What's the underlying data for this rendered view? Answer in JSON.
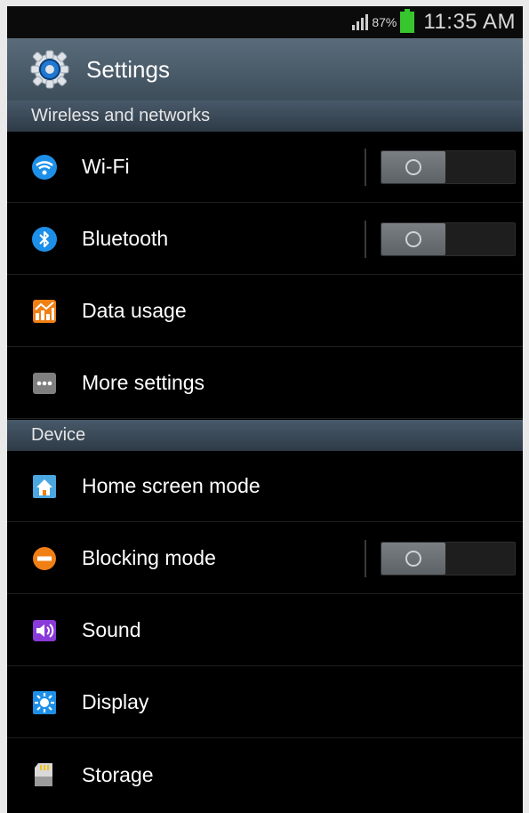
{
  "status_bar": {
    "battery": "87%",
    "time": "11:35 AM"
  },
  "title_bar": {
    "title": "Settings",
    "icon": "gear-icon"
  },
  "sections": {
    "wireless": "Wireless and networks",
    "device": "Device"
  },
  "items": {
    "wifi": {
      "label": "Wi-Fi",
      "icon": "wifi-icon",
      "toggle": "off"
    },
    "bluetooth": {
      "label": "Bluetooth",
      "icon": "bluetooth-icon",
      "toggle": "off"
    },
    "data_usage": {
      "label": "Data usage",
      "icon": "data-usage-icon"
    },
    "more_settings": {
      "label": "More settings",
      "icon": "more-icon"
    },
    "home_screen": {
      "label": "Home screen mode",
      "icon": "home-icon"
    },
    "blocking": {
      "label": "Blocking mode",
      "icon": "blocking-icon",
      "toggle": "off"
    },
    "sound": {
      "label": "Sound",
      "icon": "sound-icon"
    },
    "display": {
      "label": "Display",
      "icon": "display-icon"
    },
    "storage": {
      "label": "Storage",
      "icon": "storage-icon"
    }
  },
  "colors": {
    "battery": "#38c62e",
    "title_bar": "#4b5c6b",
    "toggle_knob": "#6b7075"
  }
}
